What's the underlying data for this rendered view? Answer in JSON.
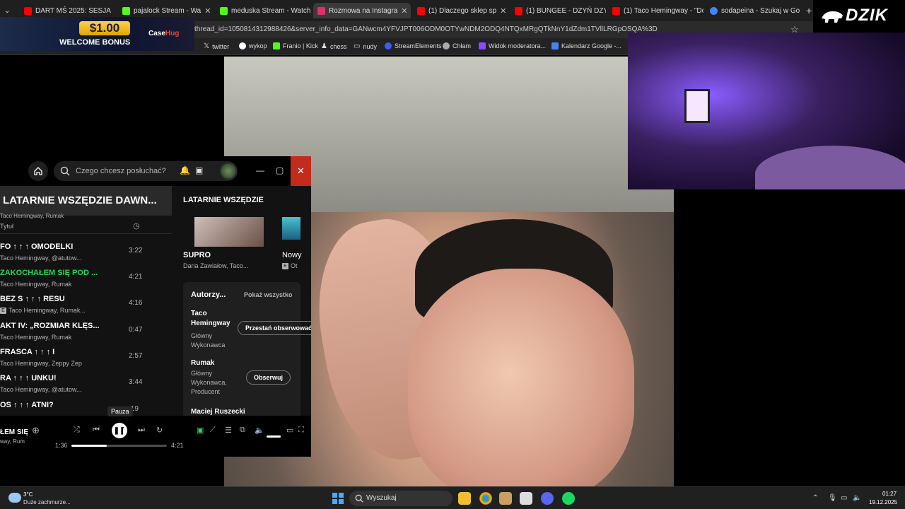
{
  "browser": {
    "tabs": [
      {
        "label": "DART MŚ 2025: SESJA",
        "color": "#ff0000"
      },
      {
        "label": "pajalock Stream - Wa",
        "color": "#53fc18"
      },
      {
        "label": "meduska Stream - Watch",
        "color": "#53fc18"
      },
      {
        "label": "Rozmowa na Instagra",
        "color": "#e1306c"
      },
      {
        "label": "(1) Dlaczego sklep sp",
        "color": "#ff0000"
      },
      {
        "label": "(1) BUNGEE - DZYŃ DZYŃ",
        "color": "#ff0000"
      },
      {
        "label": "(1) Taco Hemingway - \"Do",
        "color": "#ff0000"
      },
      {
        "label": "sodapeina - Szukaj w Go",
        "color": "#4285f4"
      }
    ],
    "url": "thread_id=1050814312988426&server_info_data=GANwcm4YFVJPT006ODM0OTYwNDM2ODQ4NTQxMRgQTkNnY1dZdm1TVllLRGpOSQA%3D",
    "bookmarks": [
      {
        "label": "twitter"
      },
      {
        "label": "wykop"
      },
      {
        "label": "Franio | Kick"
      },
      {
        "label": "chess"
      },
      {
        "label": "nudy"
      },
      {
        "label": "StreamElements"
      },
      {
        "label": "Chłam"
      },
      {
        "label": "Widok moderatora..."
      },
      {
        "label": "Kalendarz Google -..."
      }
    ]
  },
  "banner": {
    "amount": "$1.00",
    "text": "WELCOME BONUS",
    "brand_a": "Case",
    "brand_b": "Hug"
  },
  "overlay": {
    "logo": "DZIK"
  },
  "spotify": {
    "search_placeholder": "Czego chcesz posłuchać?",
    "playlist_title": "LATARNIE WSZĘDZIE DAWN...",
    "col_partial_artist": "Taco Hemingway, Rumak",
    "col_title": "Tytuł",
    "tracks": [
      {
        "title": "FO ↑ ↑ ↑ OMODELKI",
        "artist": "Taco Hemingway, @atutow...",
        "duration": "3:22",
        "explicit": false
      },
      {
        "title": "ZAKOCHAŁEM SIĘ POD ...",
        "artist": "Taco Hemingway, Rumak",
        "duration": "4:21",
        "explicit": false
      },
      {
        "title": "BEZ S ↑ ↑ ↑ RESU",
        "artist": "Taco Hemingway, Rumak...",
        "duration": "4:16",
        "explicit": true
      },
      {
        "title": "AKT IV: „ROZMIAR KLĘS...",
        "artist": "Taco Hemingway, Rumak",
        "duration": "0:47",
        "explicit": false
      },
      {
        "title": "FRASCA ↑ ↑ ↑ I",
        "artist": "Taco Hemingway, Zeppy Zep",
        "duration": "2:57",
        "explicit": false
      },
      {
        "title": "RA ↑ ↑ ↑ UNKU!",
        "artist": "Taco Hemingway, @atutow...",
        "duration": "3:44",
        "explicit": false
      },
      {
        "title": "OS ↑ ↑ ↑ ATNI?",
        "artist": "",
        "duration": ":19",
        "explicit": false
      }
    ],
    "right_title": "LATARNIE WSZĘDZIE",
    "album1_title": "SUPRO",
    "album1_artist": "Daria Zawiałow, Taco...",
    "album2_title": "Nowy",
    "album2_sub": "Ot",
    "credits_title": "Autorzy...",
    "credits_show_all": "Pokaż wszystko",
    "credits": [
      {
        "name": "Taco Hemingway",
        "role": "Główny Wykonawca",
        "button": "Przestań obserwować"
      },
      {
        "name": "Rumak",
        "role": "Główny Wykonawca, Producent",
        "button": "Obserwuj"
      },
      {
        "name": "Maciej Ruszecki",
        "role": "",
        "button": ""
      }
    ],
    "now_playing_title": "ŁEM SIĘ",
    "now_playing_artist": "way, Rum",
    "time_current": "1:36",
    "time_total": "4:21",
    "progress": 0.37,
    "tooltip": "Pauza"
  },
  "taskbar": {
    "weather_temp": "3°C",
    "weather_desc": "Duże zachmurze...",
    "search": "Wyszukaj",
    "time": "01:27",
    "date": "19.12.2025"
  }
}
